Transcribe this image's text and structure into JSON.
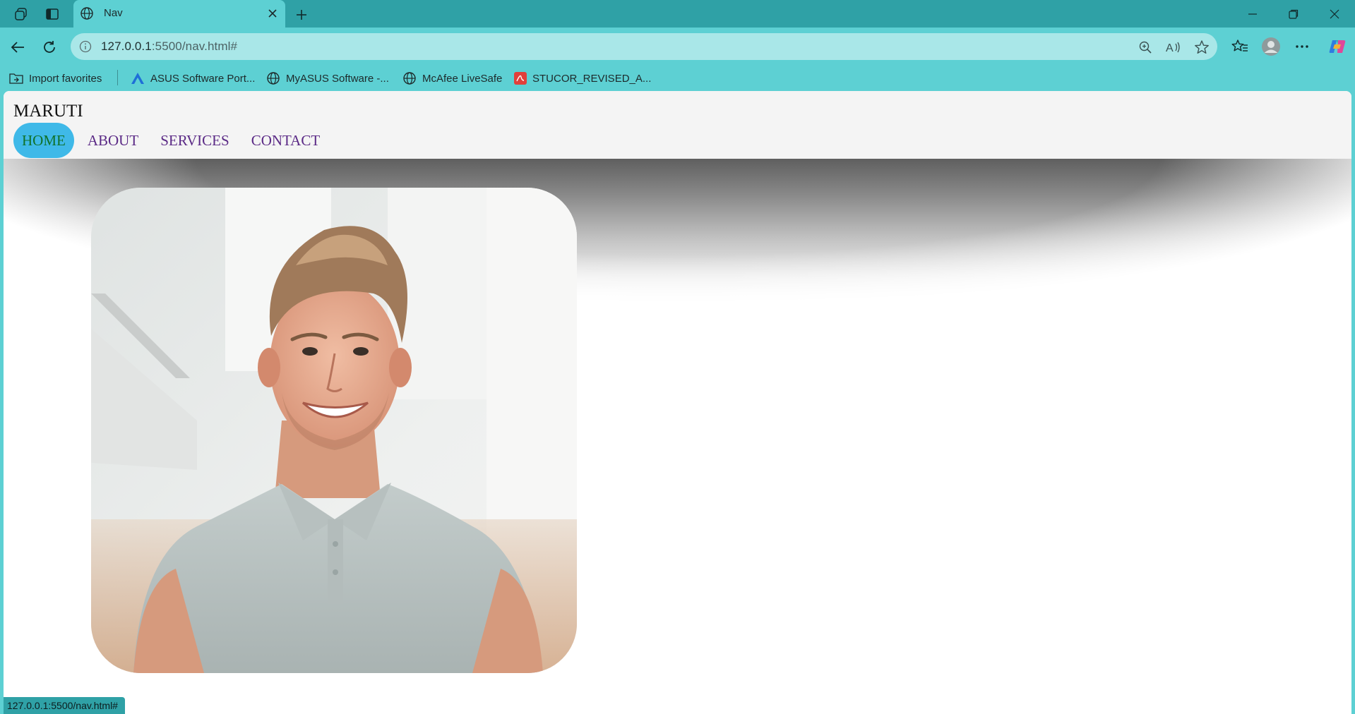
{
  "browser": {
    "tab_title": "Nav",
    "address": {
      "host": "127.0.0.1",
      "path": ":5500/nav.html#"
    },
    "status_url": "127.0.0.1:5500/nav.html#",
    "bookmarks": [
      {
        "label": "Import favorites",
        "icon": "import-folder-icon"
      },
      {
        "label": "ASUS Software Port...",
        "icon": "asus-logo-icon"
      },
      {
        "label": "MyASUS Software -...",
        "icon": "globe-icon"
      },
      {
        "label": "McAfee LiveSafe",
        "icon": "globe-icon"
      },
      {
        "label": "STUCOR_REVISED_A...",
        "icon": "pdf-icon"
      }
    ]
  },
  "site": {
    "brand": "MARUTI",
    "menu": [
      {
        "label": "HOME",
        "active": true
      },
      {
        "label": "ABOUT",
        "active": false
      },
      {
        "label": "SERVICES",
        "active": false
      },
      {
        "label": "CONTACT",
        "active": false
      }
    ],
    "colors": {
      "menu_active_bg": "#3fb9e8",
      "menu_active_text": "#10722a",
      "menu_text": "#5b2a86",
      "header_bg": "#f4f4f4"
    }
  }
}
